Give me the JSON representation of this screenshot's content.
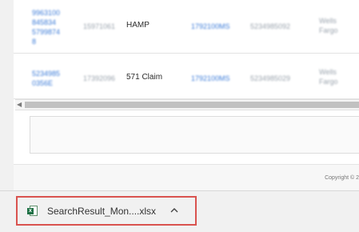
{
  "table": {
    "rows": [
      {
        "id_lines": [
          "9963100",
          "845834",
          "5799874",
          "8"
        ],
        "loan_number": "15971061",
        "type": "HAMP",
        "reference": "1792100MS",
        "account": "5234985092",
        "servicer_lines": [
          "Wells",
          "Fargo"
        ]
      },
      {
        "id_lines": [
          "5234985",
          "0356E"
        ],
        "loan_number": "17392096",
        "type": "571 Claim",
        "reference": "1792100MS",
        "account": "5234985029",
        "servicer_lines": [
          "Wells",
          "Fargo"
        ]
      }
    ]
  },
  "footer": {
    "copyright": "Copyright © 2"
  },
  "downloads": {
    "file_name": "SearchResult_Mon....xlsx",
    "icon": "excel-file-icon",
    "menu_icon": "chevron-up-icon"
  },
  "colors": {
    "highlight_border": "#d9534f",
    "link": "#3b7bd8",
    "excel_green": "#1e7145"
  }
}
